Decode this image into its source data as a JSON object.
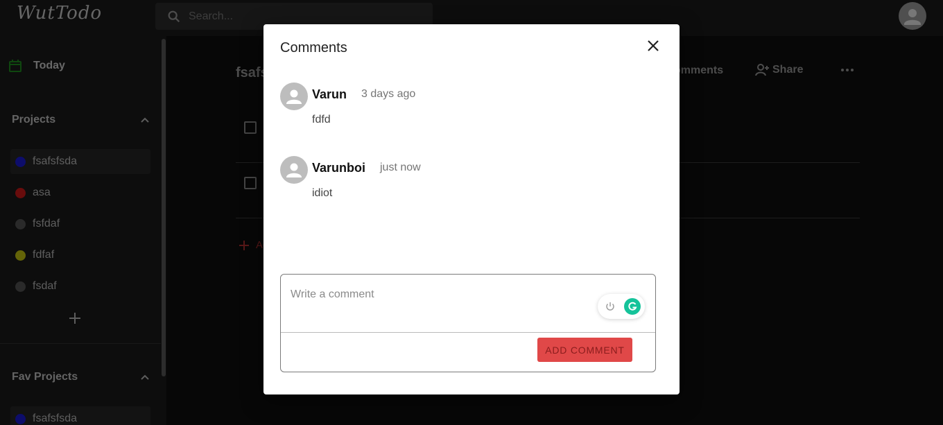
{
  "app": {
    "logo": "WutTodo"
  },
  "search": {
    "placeholder": "Search..."
  },
  "sidebar": {
    "today_label": "Today",
    "projects_header": "Projects",
    "projects": [
      {
        "label": "fsafsfsda",
        "color": "#1a1ad6"
      },
      {
        "label": "asa",
        "color": "#d01818"
      },
      {
        "label": "fsfdaf",
        "color": "#555555"
      },
      {
        "label": "fdfaf",
        "color": "#c8c810"
      },
      {
        "label": "fsdaf",
        "color": "#555555"
      }
    ],
    "fav_header": "Fav Projects",
    "fav_projects": [
      {
        "label": "fsafsfsda",
        "color": "#1a1ad6"
      }
    ]
  },
  "main": {
    "title": "fsafs",
    "comments_label": "omments",
    "share_label": "Share",
    "add_task_label": "Ad"
  },
  "modal": {
    "title": "Comments",
    "comments": [
      {
        "author": "Varun",
        "time": "3 days ago",
        "text": "fdfd"
      },
      {
        "author": "Varunboi",
        "time": "just now",
        "text": "idiot"
      }
    ],
    "input_placeholder": "Write a comment",
    "add_button_label": "ADD COMMENT"
  },
  "colors": {
    "accent": "#e04848",
    "grammarly": "#15c39a"
  }
}
